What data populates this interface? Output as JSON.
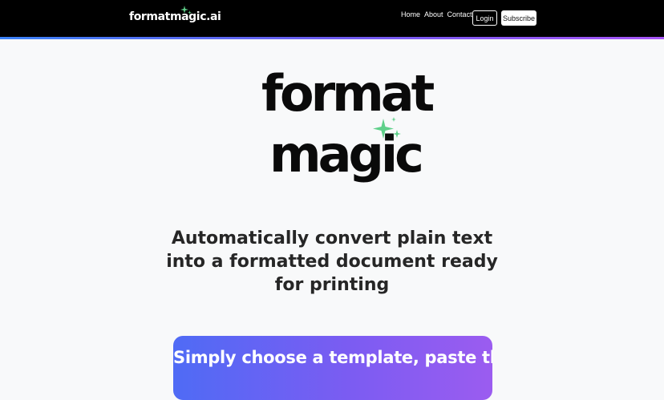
{
  "nav": {
    "brand": "formatmagic.ai",
    "links": [
      "Home",
      "About",
      "Contact"
    ],
    "login_label": "Login",
    "subscribe_label": "Subscribe",
    "sparkle_icon": "sparkle-icon"
  },
  "hero": {
    "logo_line1": "format",
    "logo_line2": "magic",
    "logo_sparkle_icon": "sparkle-icon",
    "tagline": "Automatically convert plain text into a formatted document ready for printing"
  },
  "cta": {
    "text": "Simply choose a template, paste the"
  },
  "colors": {
    "nav_bg": "#000000",
    "accent_start": "#3b82f6",
    "accent_end": "#a855f7",
    "sparkle": "#5fd08a",
    "page_bg": "#f8f9fa"
  }
}
